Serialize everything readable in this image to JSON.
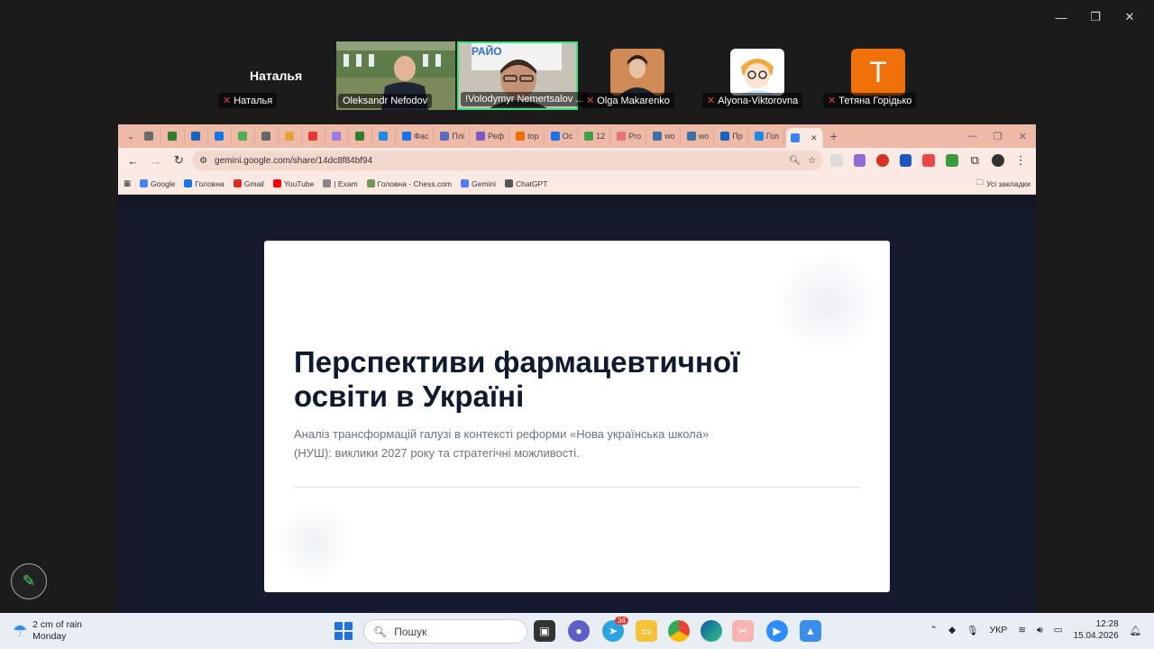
{
  "window_controls": {
    "minimize": "—",
    "restore": "❐",
    "close": "✕"
  },
  "participants": {
    "self_name": "Наталья",
    "tiles": [
      {
        "name": "Наталья",
        "muted": true
      },
      {
        "name": "Oleksandr Nefodov",
        "muted": false
      },
      {
        "name": "!Volodymyr Nemertsalov ...",
        "muted": false,
        "active_speaker": true
      },
      {
        "name": "Olga Makarenko",
        "muted": true
      },
      {
        "name": "Alyona-Viktorovna",
        "muted": true
      },
      {
        "name": "Тетяна Горідько",
        "muted": true,
        "avatar_letter": "T"
      }
    ],
    "banner_text": "РАЙО"
  },
  "browser": {
    "tabs": [
      {
        "label": "",
        "color": "#6b6b6b"
      },
      {
        "label": "",
        "color": "#2e7d32"
      },
      {
        "label": "",
        "color": "#1565c0"
      },
      {
        "label": "",
        "color": "#1a73e8"
      },
      {
        "label": "",
        "color": "#4caf50"
      },
      {
        "label": "",
        "color": "#666"
      },
      {
        "label": "",
        "color": "#e6a23c"
      },
      {
        "label": "",
        "color": "#e53935"
      },
      {
        "label": "",
        "color": "#9c7de8"
      },
      {
        "label": "",
        "color": "#2e7d32"
      },
      {
        "label": "",
        "color": "#1e88e5"
      },
      {
        "label": "Фас",
        "color": "#1a73e8"
      },
      {
        "label": "Плі",
        "color": "#5c6bc0"
      },
      {
        "label": "Реф",
        "color": "#7e57c2"
      },
      {
        "label": "top",
        "color": "#ef6c00"
      },
      {
        "label": "Ос",
        "color": "#1a73e8"
      },
      {
        "label": "12",
        "color": "#43a047"
      },
      {
        "label": "Pro",
        "color": "#e57373"
      },
      {
        "label": "wo",
        "color": "#3d6ea5"
      },
      {
        "label": "wo",
        "color": "#3d6ea5"
      },
      {
        "label": "Пр",
        "color": "#1565c0"
      },
      {
        "label": "Гол",
        "color": "#1e88e5"
      },
      {
        "label": "",
        "color": "#3b82f6",
        "active": true
      }
    ],
    "new_tab": "+",
    "url": "gemini.google.com/share/14dc8f84bf94",
    "bookmarks": [
      {
        "label": "Google",
        "color": "#4285f4"
      },
      {
        "label": "Головна",
        "color": "#1877f2"
      },
      {
        "label": "Gmail",
        "color": "#d93025"
      },
      {
        "label": "YouTube",
        "color": "#ff0000"
      },
      {
        "label": "| Exam",
        "color": "#888"
      },
      {
        "label": "Головна - Chess.com",
        "color": "#769656"
      },
      {
        "label": "Gemini",
        "color": "#4e7cf6"
      },
      {
        "label": "ChatGPT",
        "color": "#555"
      }
    ],
    "all_bookmarks": "Усі закладки"
  },
  "slide": {
    "title": "Перспективи фармацевтичної освіти в Україні",
    "subtitle": "Аналіз трансформацій галузі в контексті реформи «Нова українська школа» (НУШ): виклики 2027 року та стратегічні можливості."
  },
  "taskbar": {
    "weather_line1": "2 cm of rain",
    "weather_line2": "Monday",
    "search_placeholder": "Пошук",
    "telegram_badge": "34",
    "lang": "УКР",
    "time": "12:28",
    "date": "15.04.2026"
  }
}
